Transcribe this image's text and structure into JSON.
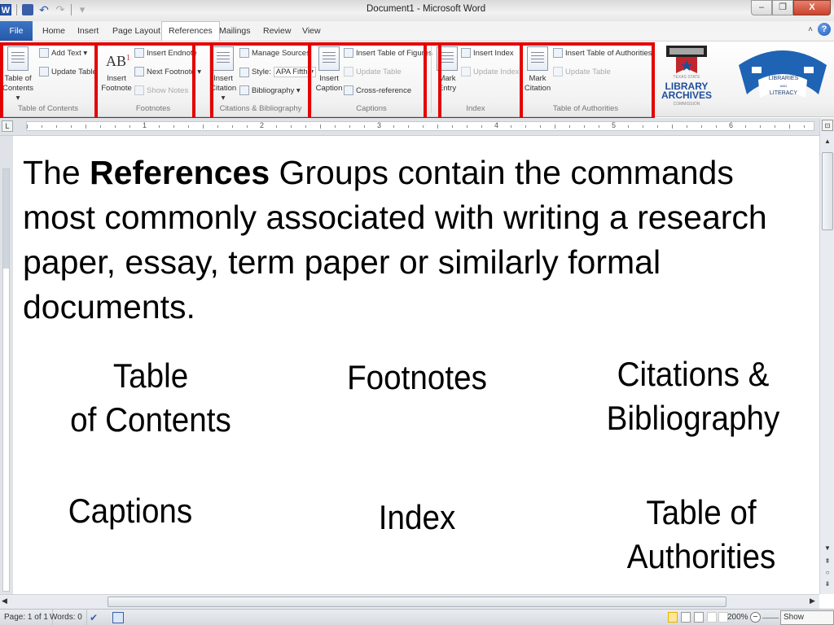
{
  "window": {
    "title": "Document1  -  Microsoft Word",
    "controls": {
      "minimize": "–",
      "restore": "❐",
      "close": "X"
    }
  },
  "quick_access": {
    "icons": [
      "word-app-icon",
      "save-icon",
      "undo-icon",
      "redo-icon",
      "customize-icon"
    ],
    "word_glyph": "W",
    "undo_glyph": "↶",
    "redo_glyph": "↷",
    "customize_glyph": "▾"
  },
  "tabs": [
    {
      "label": "File"
    },
    {
      "label": "Home"
    },
    {
      "label": "Insert"
    },
    {
      "label": "Page Layout"
    },
    {
      "label": "References",
      "active": true
    },
    {
      "label": "Mailings"
    },
    {
      "label": "Review"
    },
    {
      "label": "View"
    }
  ],
  "help": {
    "collapse_glyph": "˄",
    "help_glyph": "?"
  },
  "ribbon": {
    "toc": {
      "label": "Table of Contents",
      "big": "Table of\nContents ▾",
      "add_text": "Add Text ▾",
      "update_table": "Update Table"
    },
    "footnotes": {
      "label": "Footnotes",
      "big": "Insert\nFootnote",
      "big_glyph": "AB",
      "big_sup": "1",
      "insert_endnote": "Insert Endnote",
      "next_footnote": "Next Footnote ▾",
      "show_notes": "Show Notes"
    },
    "citations": {
      "label": "Citations & Bibliography",
      "big": "Insert\nCitation ▾",
      "manage_sources": "Manage Sources",
      "style_label": "Style:",
      "style_value": "APA Fifth ▾",
      "bibliography": "Bibliography ▾"
    },
    "captions": {
      "label": "Captions",
      "big": "Insert\nCaption",
      "insert_tof": "Insert Table of Figures",
      "update_table": "Update Table",
      "cross_reference": "Cross-reference"
    },
    "index": {
      "label": "Index",
      "big": "Mark\nEntry",
      "insert_index": "Insert Index",
      "update_index": "Update Index"
    },
    "toa": {
      "label": "Table of Authorities",
      "big": "Mark\nCitation",
      "insert_toa": "Insert Table of Authorities",
      "update_table": "Update Table"
    }
  },
  "logos": {
    "tslac": {
      "line1": "TEXAS STATE",
      "line2": "LIBRARY",
      "line3": "ARCHIVES",
      "line4": "COMMISSION"
    },
    "literacy": {
      "line1": "LIBRARIES",
      "line2": "AND",
      "line3": "LITERACY"
    }
  },
  "ruler": {
    "tab_selector": "L",
    "numbers": [
      "1",
      "2",
      "3",
      "4",
      "5",
      "6"
    ]
  },
  "document": {
    "intro_pre": "The ",
    "intro_bold": "References",
    "intro_post": " Groups contain the commands most commonly associated with writing a research paper, essay, term paper or similarly formal documents.",
    "groups": [
      {
        "label": "Table\nof Contents"
      },
      {
        "label": "Footnotes"
      },
      {
        "label": "Citations &\nBibliography"
      },
      {
        "label": "Captions"
      },
      {
        "label": "Index"
      },
      {
        "label": "Table of\nAuthorities"
      }
    ]
  },
  "statusbar": {
    "page": "Page: 1 of 1",
    "words": "Words: 0",
    "zoom": "200%",
    "zoom_minus": "−",
    "show_desktop": "Show desktop"
  },
  "colors": {
    "highlight_box": "#e30000",
    "file_tab": "#2a5fb0",
    "accent": "#1d5bbf"
  }
}
